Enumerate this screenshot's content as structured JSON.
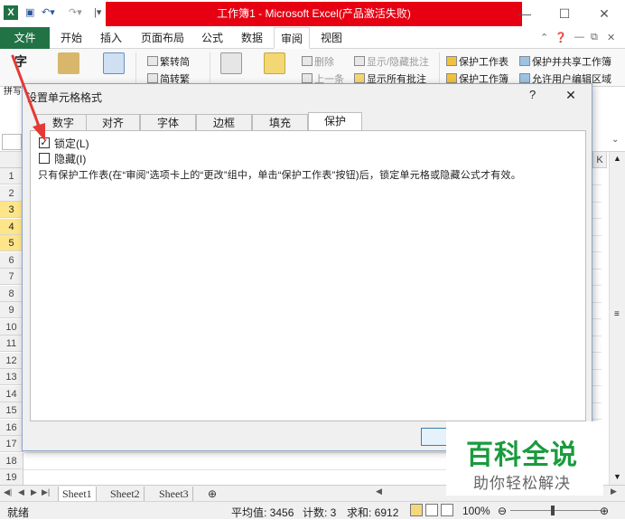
{
  "app": {
    "title": "工作簿1 - Microsoft Excel(产品激活失败)",
    "logo": "X"
  },
  "tabs": [
    {
      "label": "文件"
    },
    {
      "label": "开始"
    },
    {
      "label": "插入"
    },
    {
      "label": "页面布局"
    },
    {
      "label": "公式"
    },
    {
      "label": "数据"
    },
    {
      "label": "审阅"
    },
    {
      "label": "视图"
    }
  ],
  "ribbon": {
    "group_label": "拼写",
    "proof_label": "字",
    "trad": "繁转简",
    "simp": "简转繁",
    "delete": "删除",
    "prev": "上一条",
    "show_hide": "显示/隐藏批注",
    "show_all": "显示所有批注",
    "protect_sheet": "保护工作表",
    "protect_book": "保护工作簿",
    "protect_share": "保护并共享工作簿",
    "allow_edit": "允许用户编辑区域"
  },
  "grid": {
    "rows": [
      "1",
      "2",
      "3",
      "4",
      "5",
      "6",
      "7",
      "8",
      "9",
      "10",
      "11",
      "12",
      "13",
      "14",
      "15",
      "16",
      "17",
      "18",
      "19"
    ],
    "selected_rows": [
      "3",
      "4",
      "5"
    ],
    "col_k": "K"
  },
  "dialog": {
    "title": "设置单元格格式",
    "help": "?",
    "close": "✕",
    "tabs": [
      "数字",
      "对齐",
      "字体",
      "边框",
      "填充",
      "保护"
    ],
    "active_tab": "保护",
    "locked_label": "锁定(L)",
    "locked_checked": true,
    "hidden_label": "隐藏(I)",
    "hidden_checked": false,
    "description": "只有保护工作表(在“审阅”选项卡上的“更改”组中，单击“保护工作表”按钮)后，锁定单元格或隐藏公式才有效。"
  },
  "sheets": [
    "Sheet1",
    "Sheet2",
    "Sheet3"
  ],
  "status": {
    "ready": "就绪",
    "average": "平均值: 3456",
    "count": "计数: 3",
    "sum": "求和: 6912",
    "zoom": "100%"
  },
  "watermark": {
    "title": "百科全说",
    "subtitle": "助你轻松解决"
  },
  "colors": {
    "excel_green": "#217346",
    "title_red": "#e60012",
    "row_highlight": "#ffe58a",
    "arrow": "#e53935",
    "watermark_green": "#1a9b3e"
  }
}
